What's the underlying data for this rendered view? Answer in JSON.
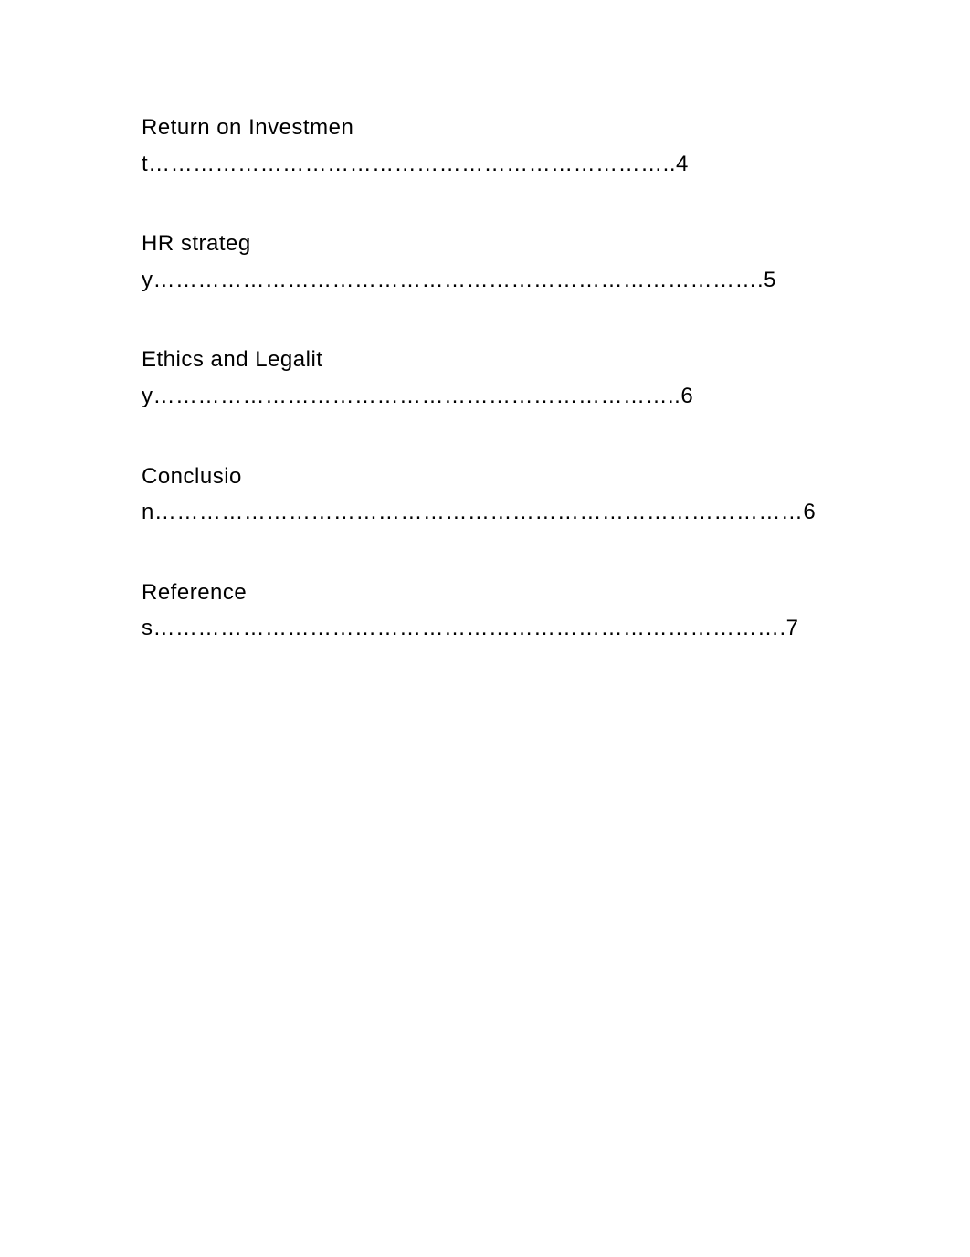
{
  "toc": {
    "entries": [
      {
        "text": "Return on Investment……………………………………………………………..4"
      },
      {
        "text": "HR strategy……………………………………………………………………….5"
      },
      {
        "text": "Ethics and Legality……………………………………………………………..6"
      },
      {
        "text": "Conclusion……………………………………………………………………………6"
      },
      {
        "text": "References………………………………………………………………………….7"
      }
    ]
  }
}
